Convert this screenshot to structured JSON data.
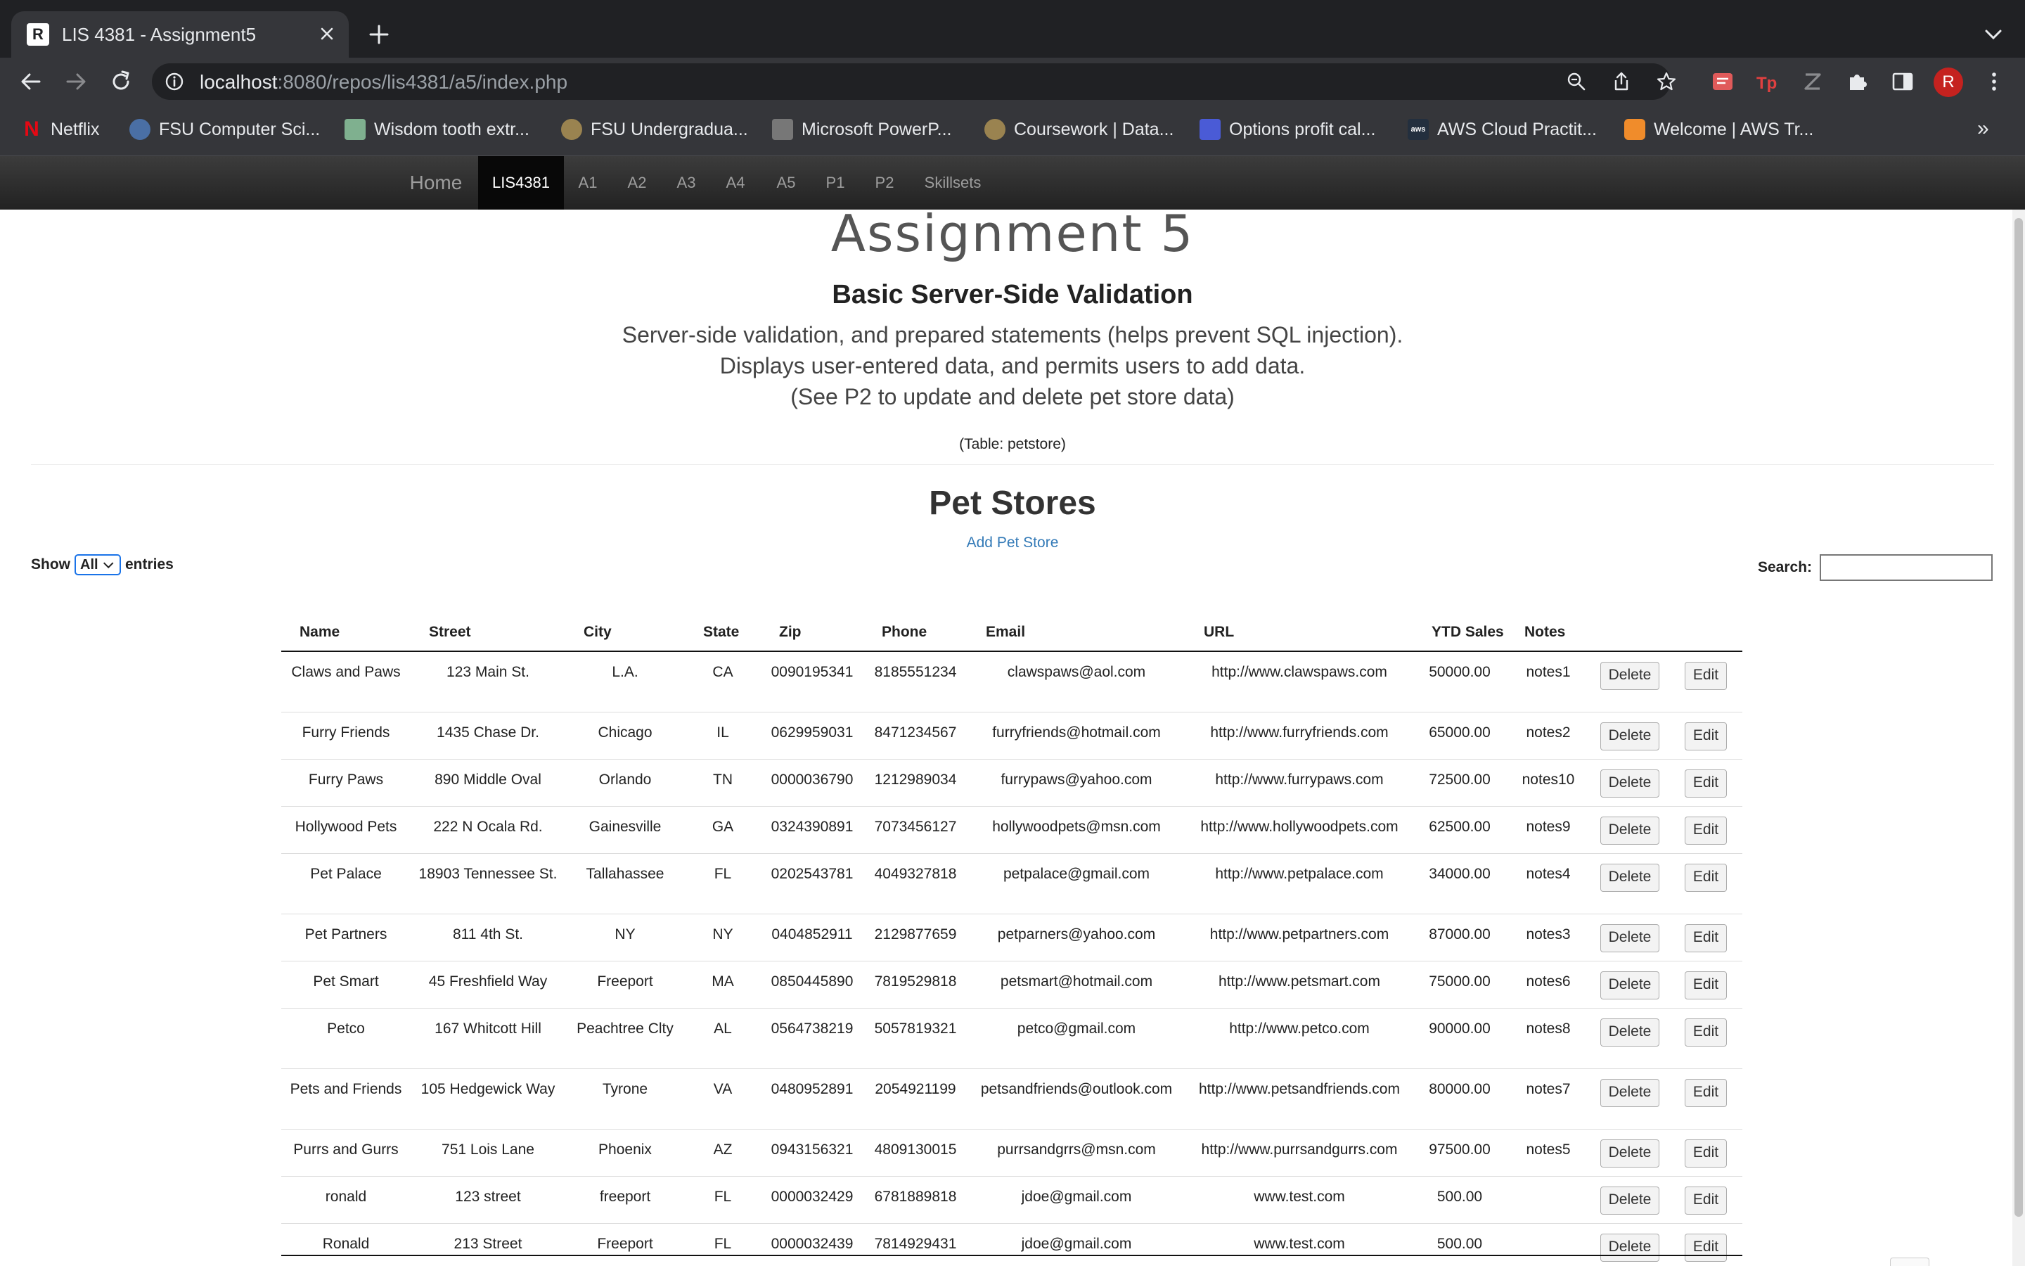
{
  "browser": {
    "tab_title": "LIS 4381 - Assignment5",
    "tab_favicon_letter": "R",
    "url_host": "localhost",
    "url_rest": ":8080/repos/lis4381/a5/index.php",
    "profile_initial": "R",
    "bookmarks": [
      {
        "label": "Netflix",
        "icon": "netflix-icon",
        "color": "#e50914",
        "glyph": "N"
      },
      {
        "label": "FSU Computer Sci...",
        "icon": "fsu-cs-icon",
        "color": "#4a6fa5",
        "glyph": ""
      },
      {
        "label": "Wisdom tooth extr...",
        "icon": "wisdom-tooth-icon",
        "color": "#7fb08f",
        "glyph": ""
      },
      {
        "label": "FSU Undergradua...",
        "icon": "fsu-seal-icon",
        "color": "#9a8350",
        "glyph": ""
      },
      {
        "label": "Microsoft PowerP...",
        "icon": "powerpoint-icon",
        "color": "#777777",
        "glyph": ""
      },
      {
        "label": "Coursework | Data...",
        "icon": "coursework-icon",
        "color": "#9a8350",
        "glyph": ""
      },
      {
        "label": "Options profit cal...",
        "icon": "options-calc-icon",
        "color": "#4a5bd6",
        "glyph": ""
      },
      {
        "label": "AWS Cloud Practit...",
        "icon": "aws-icon",
        "color": "#232f3e",
        "glyph": "aws"
      },
      {
        "label": "Welcome | AWS Tr...",
        "icon": "aws-training-icon",
        "color": "#f08c2b",
        "glyph": ""
      }
    ],
    "bookmarks_overflow": "»"
  },
  "site_nav": {
    "brand": "Home",
    "items": [
      "LIS4381",
      "A1",
      "A2",
      "A3",
      "A4",
      "A5",
      "P1",
      "P2",
      "Skillsets"
    ],
    "active": "LIS4381"
  },
  "page": {
    "title": "Assignment 5",
    "subtitle": "Basic Server-Side Validation",
    "description_lines": [
      "Server-side validation, and prepared statements (helps prevent SQL injection).",
      "Displays user-entered data, and permits users to add data.",
      "(See P2 to update and delete pet store data)"
    ],
    "table_note": "(Table: petstore)",
    "section_title": "Pet Stores",
    "add_link": "Add Pet Store",
    "show_label": "Show",
    "entries_value": "All",
    "entries_label": "entries",
    "search_label": "Search:",
    "search_value": ""
  },
  "table": {
    "headers": [
      "Name",
      "Street",
      "City",
      "State",
      "Zip",
      "Phone",
      "Email",
      "URL",
      "YTD Sales",
      "Notes",
      "",
      ""
    ],
    "delete_label": "Delete",
    "edit_label": "Edit",
    "rows": [
      [
        "Claws and Paws",
        "123 Main St.",
        "L.A.",
        "CA",
        "0090195341",
        "8185551234",
        "clawspaws@aol.com",
        "http://www.clawspaws.com",
        "50000.00",
        "notes1"
      ],
      [
        "Furry Friends",
        "1435 Chase Dr.",
        "Chicago",
        "IL",
        "0629959031",
        "8471234567",
        "furryfriends@hotmail.com",
        "http://www.furryfriends.com",
        "65000.00",
        "notes2"
      ],
      [
        "Furry Paws",
        "890 Middle Oval",
        "Orlando",
        "TN",
        "0000036790",
        "1212989034",
        "furrypaws@yahoo.com",
        "http://www.furrypaws.com",
        "72500.00",
        "notes10"
      ],
      [
        "Hollywood Pets",
        "222 N Ocala Rd.",
        "Gainesville",
        "GA",
        "0324390891",
        "7073456127",
        "hollywoodpets@msn.com",
        "http://www.hollywoodpets.com",
        "62500.00",
        "notes9"
      ],
      [
        "Pet Palace",
        "18903 Tennessee St.",
        "Tallahassee",
        "FL",
        "0202543781",
        "4049327818",
        "petpalace@gmail.com",
        "http://www.petpalace.com",
        "34000.00",
        "notes4"
      ],
      [
        "Pet Partners",
        "811 4th St.",
        "NY",
        "NY",
        "0404852911",
        "2129877659",
        "petparners@yahoo.com",
        "http://www.petpartners.com",
        "87000.00",
        "notes3"
      ],
      [
        "Pet Smart",
        "45 Freshfield Way",
        "Freeport",
        "MA",
        "0850445890",
        "7819529818",
        "petsmart@hotmail.com",
        "http://www.petsmart.com",
        "75000.00",
        "notes6"
      ],
      [
        "Petco",
        "167 Whitcott Hill",
        "Peachtree Clty",
        "AL",
        "0564738219",
        "5057819321",
        "petco@gmail.com",
        "http://www.petco.com",
        "90000.00",
        "notes8"
      ],
      [
        "Pets and Friends",
        "105 Hedgewick Way",
        "Tyrone",
        "VA",
        "0480952891",
        "2054921199",
        "petsandfriends@outlook.com",
        "http://www.petsandfriends.com",
        "80000.00",
        "notes7"
      ],
      [
        "Purrs and Gurrs",
        "751 Lois Lane",
        "Phoenix",
        "AZ",
        "0943156321",
        "4809130015",
        "purrsandgrrs@msn.com",
        "http://www.purrsandgurrs.com",
        "97500.00",
        "notes5"
      ],
      [
        "ronald",
        "123 street",
        "freeport",
        "FL",
        "0000032429",
        "6781889818",
        "jdoe@gmail.com",
        "www.test.com",
        "500.00",
        ""
      ],
      [
        "Ronald",
        "213 Street",
        "Freeport",
        "FL",
        "0000032439",
        "7814929431",
        "jdoe@gmail.com",
        "www.test.com",
        "500.00",
        ""
      ]
    ]
  }
}
